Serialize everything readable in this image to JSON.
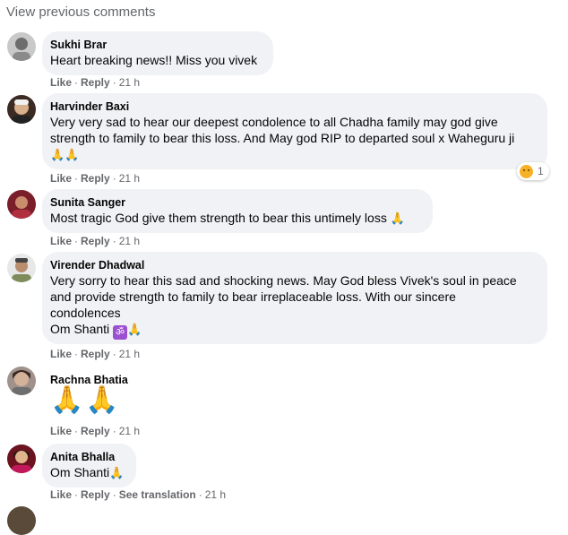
{
  "header": {
    "view_previous": "View previous comments"
  },
  "action_labels": {
    "like": "Like",
    "reply": "Reply",
    "see_translation": "See translation",
    "dot": "·"
  },
  "comments": [
    {
      "author": "Sukhi Brar",
      "text": "Heart breaking news!! Miss you vivek",
      "time": "21 h"
    },
    {
      "author": "Harvinder Baxi",
      "line1": "Very very sad to hear our deepest condolence to all Chadha family may god give",
      "line2": "strength to family to bear this loss. And May god RIP to departed soul x Waheguru ji",
      "emoji": "🙏🙏",
      "reaction_count": "1",
      "time": "21 h"
    },
    {
      "author": "Sunita Sanger",
      "text": "Most tragic God give them strength to bear this untimely loss",
      "emoji": "🙏",
      "time": "21 h"
    },
    {
      "author": "Virender Dhadwal",
      "line1": "Very sorry to hear this sad and shocking news. May God bless Vivek's soul in peace",
      "line2": "and provide strength to family to bear irreplaceable loss. With our sincere",
      "line3": "condolences",
      "line4": "Om Shanti",
      "om_symbol": "ॐ",
      "emoji": "🙏",
      "time": "21 h"
    },
    {
      "author": "Rachna Bhatia",
      "emoji": "🙏🙏",
      "time": "21 h"
    },
    {
      "author": "Anita Bhalla",
      "text": "Om Shanti",
      "emoji": "🙏",
      "time": "21 h"
    }
  ],
  "colors": {
    "bubble": "#f0f2f5",
    "meta": "#65676b",
    "text": "#050505"
  }
}
